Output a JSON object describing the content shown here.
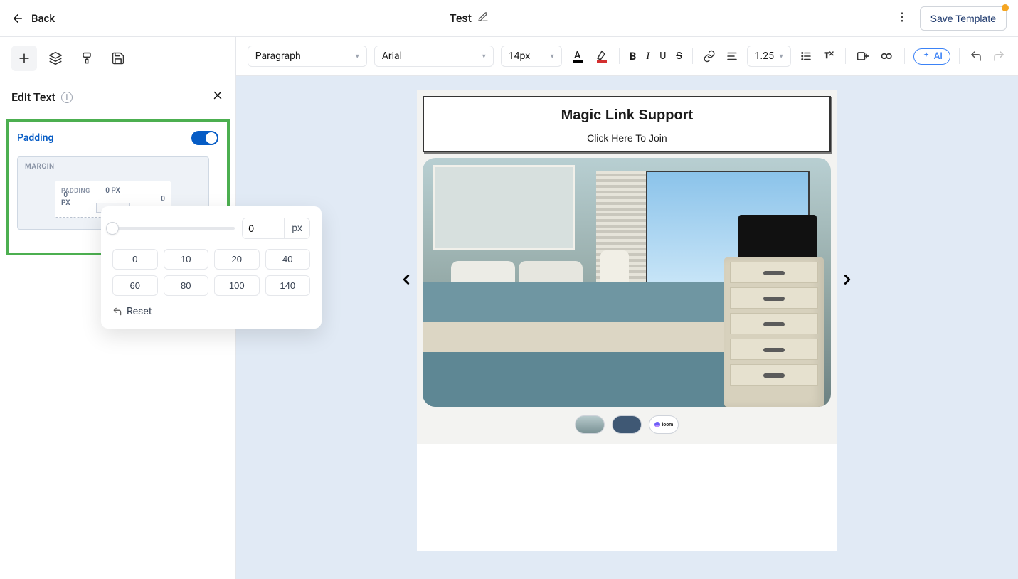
{
  "header": {
    "back": "Back",
    "title": "Test",
    "save": "Save Template"
  },
  "panel": {
    "title": "Edit Text"
  },
  "padding": {
    "label": "Padding",
    "marginLabel": "MARGIN",
    "paddingLabel": "PADDING",
    "topValue": "0 PX",
    "leftValue": "0",
    "leftUnit": "PX",
    "rightValue": "0"
  },
  "popover": {
    "value": "0",
    "unit": "px",
    "presets": [
      "0",
      "10",
      "20",
      "40",
      "60",
      "80",
      "100",
      "140"
    ],
    "reset": "Reset"
  },
  "toolbar": {
    "style": "Paragraph",
    "font": "Arial",
    "size": "14px",
    "lineHeight": "1.25",
    "ai": "AI"
  },
  "content": {
    "cardTitle": "Magic Link Support",
    "cardLink": "Click Here To Join",
    "loomLabel": "loom"
  }
}
